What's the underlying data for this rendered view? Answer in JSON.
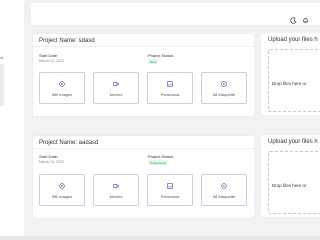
{
  "sidebar": {
    "fragment": "ct."
  },
  "header": {
    "theme_icon": "moon-icon",
    "notification_icon": "bell-icon",
    "user_name": "An",
    "user_sub": "..."
  },
  "projects": [
    {
      "name_label": "Project Name: sdasd",
      "start_label": "Start Date:",
      "start_value": "March 13, 2022",
      "status_label": "Project Status:",
      "status_value": "New",
      "buttons": [
        {
          "label": "Still Images",
          "icon": "aperture-icon"
        },
        {
          "label": "Movies",
          "icon": "video-icon"
        },
        {
          "label": "Panorama",
          "icon": "image-icon"
        },
        {
          "label": "All Maquette",
          "icon": "play-icon"
        }
      ],
      "upload_title": "Upload your files h",
      "drop_text": "Drop files here or"
    },
    {
      "name_label": "Project Name: aadasd",
      "start_label": "Start Date:",
      "start_value": "March 14, 2022",
      "status_label": "Project Status:",
      "status_value": "Progressing",
      "buttons": [
        {
          "label": "Still Images",
          "icon": "aperture-icon"
        },
        {
          "label": "Movies",
          "icon": "video-icon"
        },
        {
          "label": "Panorama",
          "icon": "image-icon"
        },
        {
          "label": "All Maquette",
          "icon": "play-icon"
        }
      ],
      "upload_title": "Upload your files h",
      "drop_text": "Drop files here or"
    }
  ],
  "colors": {
    "background": "#f2f2f4",
    "card": "#ffffff",
    "button_border": "#c8cee6",
    "status_green": "#2a9d55"
  }
}
